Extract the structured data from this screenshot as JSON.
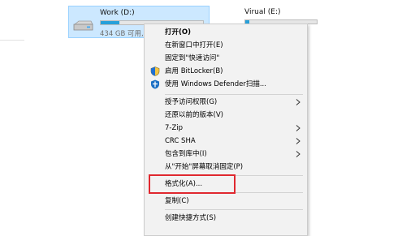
{
  "drives": [
    {
      "name": "Work (D:)",
      "free_text": "434 GB 可用,",
      "usage_fraction": 0.18
    },
    {
      "name": "Virual (E:)",
      "free_text": "",
      "usage_fraction": 0.06
    }
  ],
  "context_menu": {
    "items": [
      {
        "label": "打开(O)",
        "bold": true
      },
      {
        "label": "在新窗口中打开(E)"
      },
      {
        "label": "固定到\"快速访问\""
      },
      {
        "label": "启用 BitLocker(B)",
        "icon": "shield-icon"
      },
      {
        "label": "使用 Windows Defender扫描...",
        "icon": "defender-icon"
      },
      {
        "label": "授予访问权限(G)",
        "submenu": true
      },
      {
        "label": "还原以前的版本(V)"
      },
      {
        "label": "7-Zip",
        "submenu": true
      },
      {
        "label": "CRC SHA",
        "submenu": true
      },
      {
        "label": "包含到库中(I)",
        "submenu": true
      },
      {
        "label": "从\"开始\"屏幕取消固定(P)"
      },
      {
        "label": "格式化(A)...",
        "highlighted": true
      },
      {
        "label": "复制(C)"
      },
      {
        "label": "创建快捷方式(S)"
      }
    ]
  },
  "colors": {
    "selection_bg": "#cce8ff",
    "bar_fill": "#26a0da",
    "highlight_border": "#e0282f",
    "menu_bg": "#f2f2f2"
  }
}
